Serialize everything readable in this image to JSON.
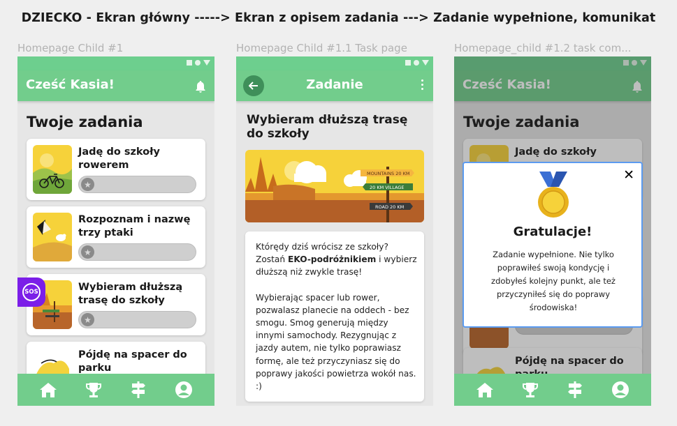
{
  "headline": "DZIECKO - Ekran główny -----> Ekran z opisem zadania ---> Zadanie wypełnione, komunikat",
  "frames": [
    {
      "label": "Homepage Child #1"
    },
    {
      "label": "Homepage Child #1.1 Task page"
    },
    {
      "label": "Homepage_child #1.2 task com..."
    }
  ],
  "colors": {
    "primary": "#72cd8c",
    "sos": "#7b1ee8",
    "modal_border": "#5b9bf0"
  },
  "home": {
    "greeting": "Cześć Kasia!",
    "section_title": "Twoje zadania",
    "tasks": [
      {
        "label": "Jadę do szkoły rowerem",
        "progress": 0
      },
      {
        "label": "Rozpoznam i nazwę trzy ptaki",
        "progress": 0
      },
      {
        "label": "Wybieram dłuższą trasę do szkoły",
        "progress": 0
      },
      {
        "label": "Pójdę na spacer do parku",
        "progress": 0
      }
    ],
    "sos_label": "SOS"
  },
  "task_page": {
    "appbar_title": "Zadanie",
    "task_title": "Wybieram dłuższą trasę do szkoły",
    "signs": [
      "MOUNTAINS 20 KM",
      "20 KM VILLAGE",
      "ROAD 20 KM"
    ],
    "paragraph1_pre": "Którędy dziś wrócisz ze szkoły? Zostań ",
    "paragraph1_bold": "EKO-podróżnikiem",
    "paragraph1_post": " i wybierz dłuższą niż zwykle trasę!",
    "paragraph2": "Wybierając spacer lub rower, pozwalasz planecie na oddech - bez smogu. Smog generują między innymi samochody. Rezygnując z jazdy autem, nie tylko poprawiasz formę, ale też przyczyniasz się do poprawy jakości powietrza wokół nas. :)"
  },
  "completed": {
    "greeting": "Cześć Kasia!",
    "section_title": "Twoje zadania",
    "task_first": "Jadę do szkoły",
    "task_last": "Pójdę na spacer do parku",
    "modal_title": "Gratulacje!",
    "modal_message": "Zadanie wypełnione.  Nie tylko poprawiłeś swoją kondycję i zdobyłeś kolejny punkt, ale też przyczyniłeś się do poprawy środowiska!",
    "close_symbol": "✕"
  },
  "nav": {
    "icons": [
      "home-icon",
      "trophy-icon",
      "signpost-icon",
      "profile-icon"
    ]
  }
}
